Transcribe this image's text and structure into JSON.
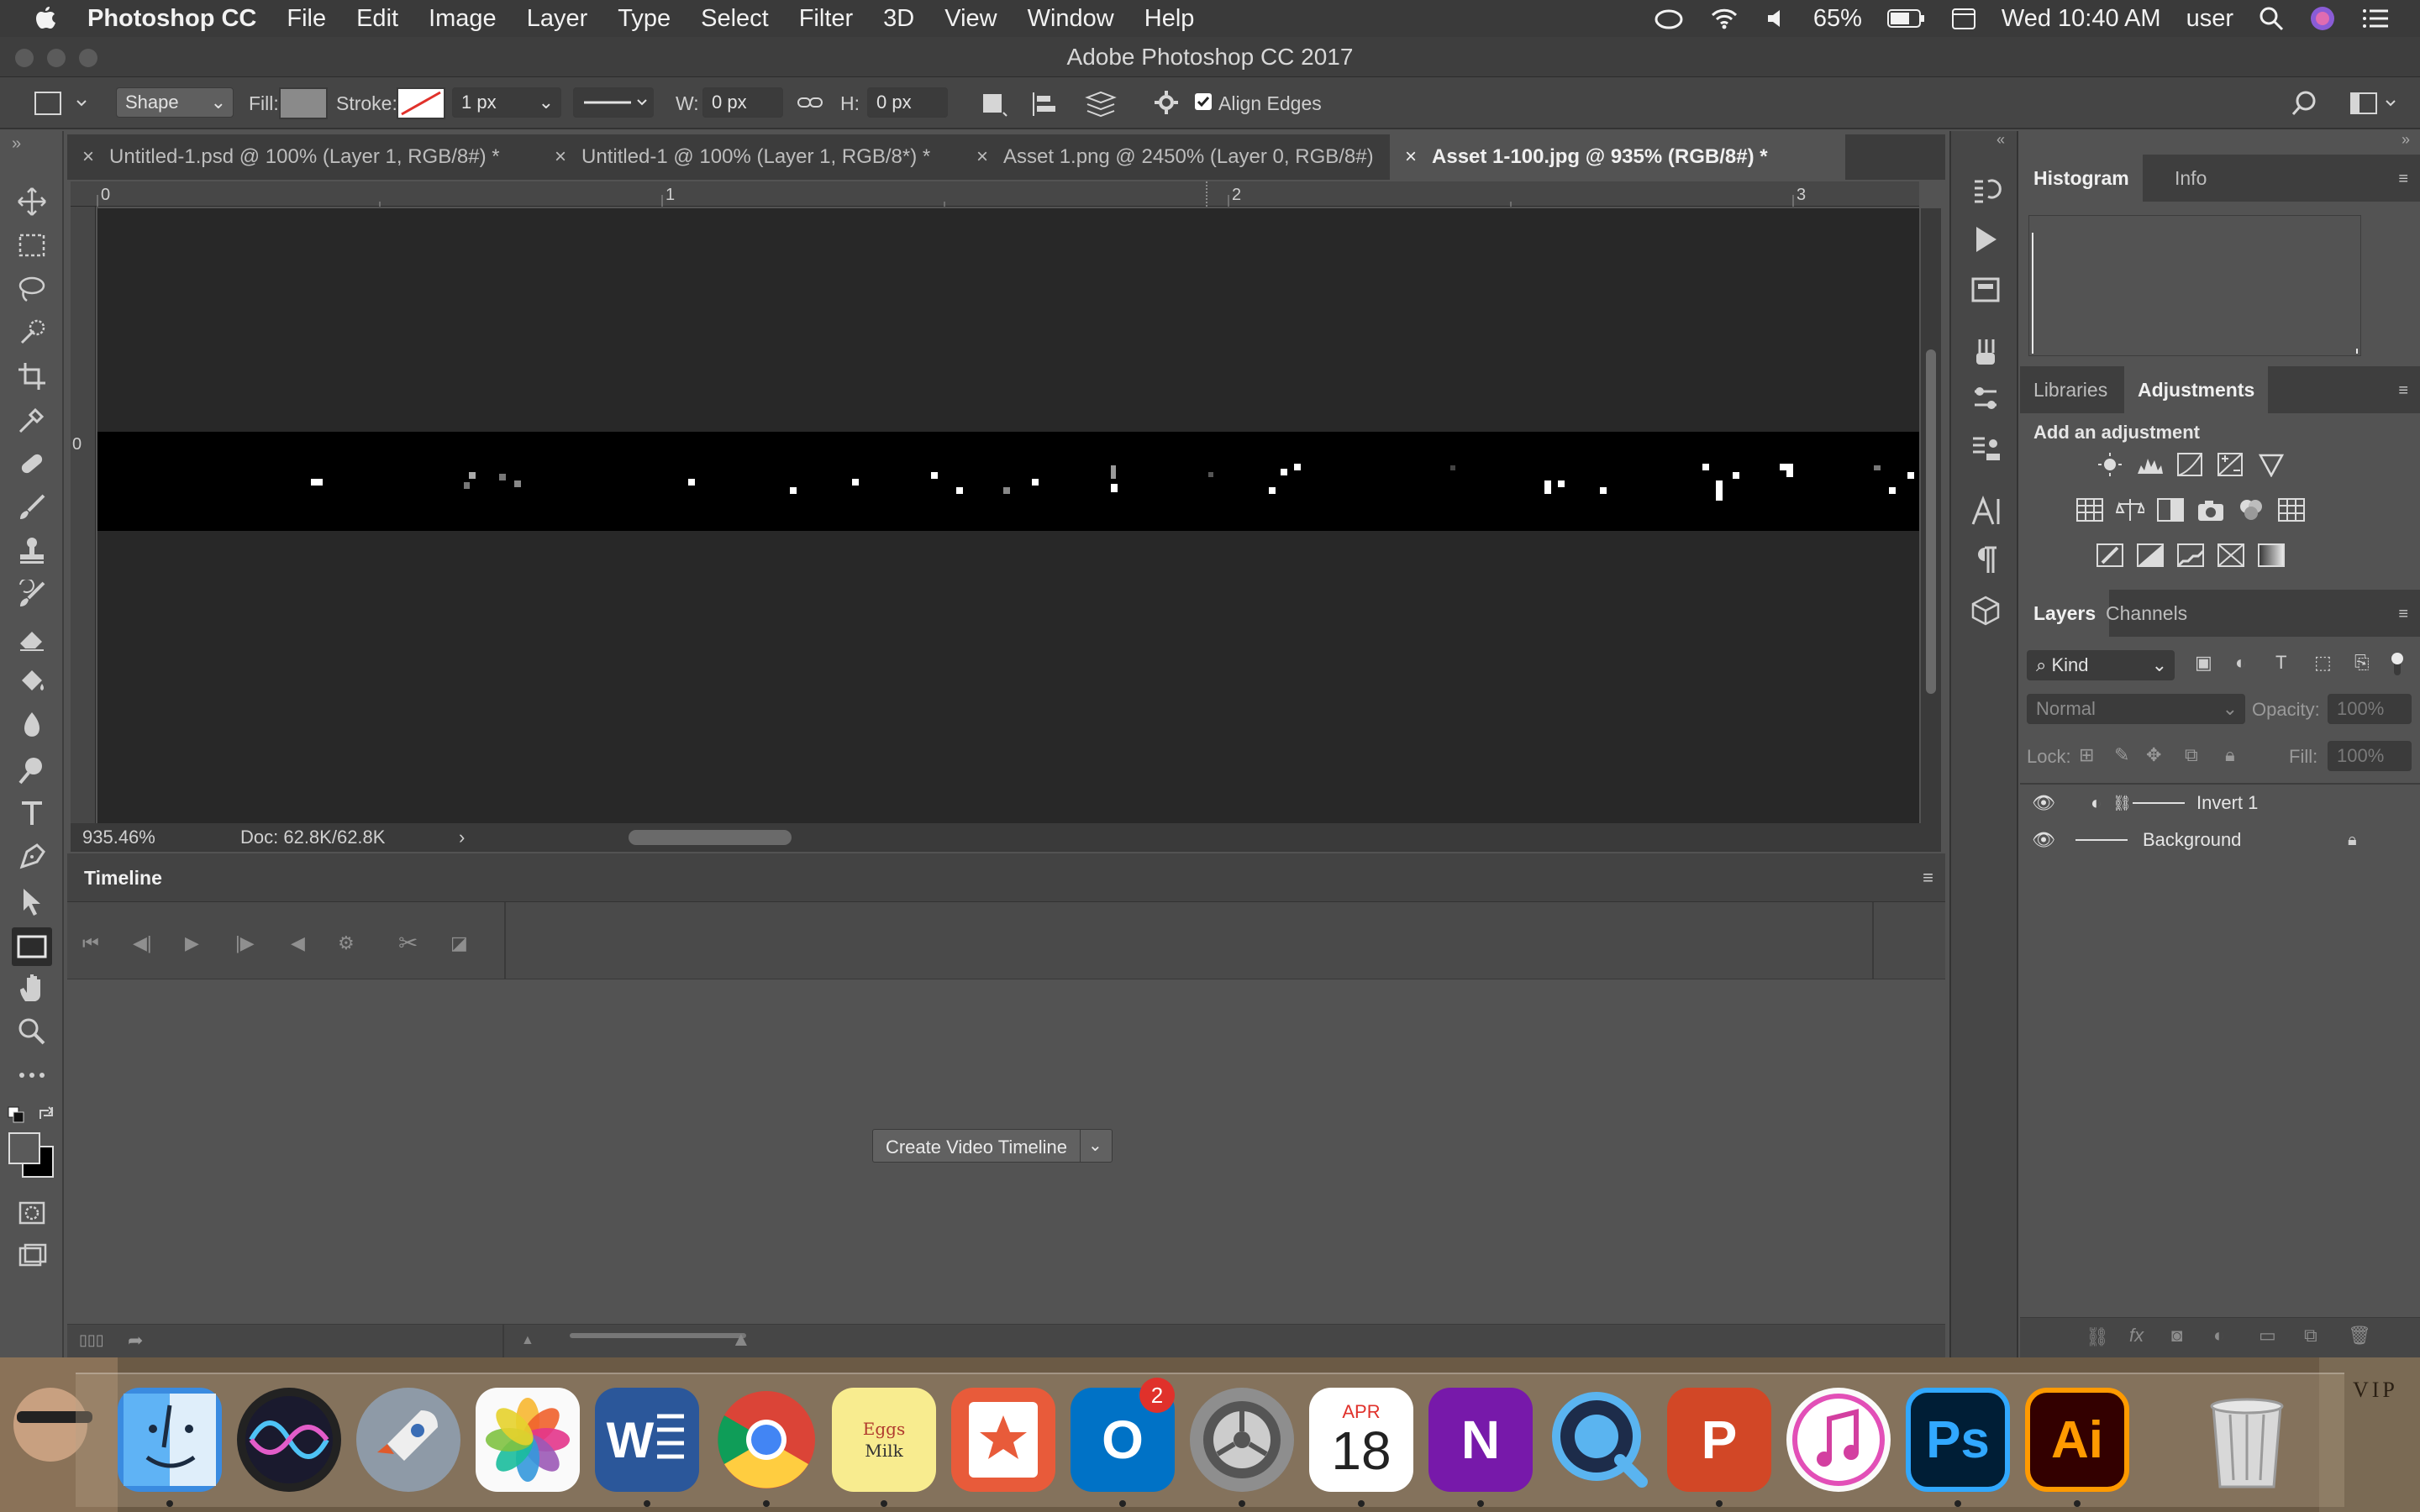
{
  "menubar": {
    "apple": "",
    "app": "Photoshop CC",
    "items": [
      "File",
      "Edit",
      "Image",
      "Layer",
      "Type",
      "Select",
      "Filter",
      "3D",
      "View",
      "Window",
      "Help"
    ],
    "battery": "65%",
    "clock": "Wed 10:40 AM",
    "user": "user"
  },
  "window": {
    "title": "Adobe Photoshop CC 2017"
  },
  "options": {
    "mode": "Shape",
    "fill_label": "Fill:",
    "stroke_label": "Stroke:",
    "stroke_width": "1 px",
    "w_label": "W:",
    "w_value": "0 px",
    "h_label": "H:",
    "h_value": "0 px",
    "align_edges": "Align Edges"
  },
  "tabs": [
    {
      "label": "Untitled-1.psd @ 100% (Layer 1, RGB/8#) *"
    },
    {
      "label": "Untitled-1 @ 100% (Layer 1, RGB/8*) *"
    },
    {
      "label": "Asset 1.png @ 2450% (Layer 0, RGB/8#)"
    },
    {
      "label": "Asset 1-100.jpg @ 935% (RGB/8#) *"
    }
  ],
  "rulers": {
    "h": [
      "0",
      "1",
      "2",
      "3"
    ],
    "v": [
      "0"
    ]
  },
  "status": {
    "zoom": "935.46%",
    "doc": "Doc: 62.8K/62.8K",
    "arrow": "›"
  },
  "timeline": {
    "title": "Timeline",
    "create_button": "Create Video Timeline"
  },
  "panels": {
    "histogram_tab": "Histogram",
    "info_tab": "Info",
    "libraries_tab": "Libraries",
    "adjustments_tab": "Adjustments",
    "add_adjustment": "Add an adjustment",
    "layers_tab": "Layers",
    "channels_tab": "Channels",
    "kind": "Kind",
    "blend_mode": "Normal",
    "opacity_label": "Opacity:",
    "opacity_value": "100%",
    "lock_label": "Lock:",
    "fill_label": "Fill:",
    "fill_value": "100%",
    "layers": [
      {
        "name": "Invert 1"
      },
      {
        "name": "Background"
      }
    ]
  },
  "dock": {
    "calendar_month": "APR",
    "calendar_day": "18",
    "outlook_badge": "2",
    "notes_line1": "Eggs",
    "notes_line2": "Milk",
    "vip_text": "VIP",
    "apps": [
      "Finder",
      "Siri",
      "Launchpad",
      "Photos",
      "Word",
      "Chrome",
      "Stickies",
      "Toolbox",
      "Outlook",
      "System Preferences",
      "Calendar",
      "OneNote",
      "QuickTime",
      "PowerPoint",
      "iTunes",
      "Photoshop",
      "Illustrator",
      "Trash"
    ]
  },
  "colors": {
    "accent_blue": "#31a8ff",
    "illustrator_orange": "#ff9a00",
    "badge_red": "#e0312b"
  }
}
